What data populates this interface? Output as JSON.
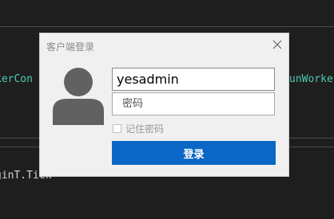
{
  "colors": {
    "background": "#1e1e1e",
    "dialog_bg": "#f0f0f0",
    "accent": "#0a67c6",
    "code_cyan": "#4ec9b0",
    "code_text": "#d4d4d4"
  },
  "background_code": {
    "line1_left": "kerCon",
    "line1_right": "unWorke",
    "line2": "ginT.Tick"
  },
  "dialog": {
    "title": "客户端登录",
    "close_icon": "close-icon",
    "avatar_icon": "user-silhouette-icon",
    "username_value": "yesadmin",
    "password_placeholder": "密码",
    "remember_label": "记住密码",
    "remember_checked": false,
    "login_label": "登录"
  }
}
